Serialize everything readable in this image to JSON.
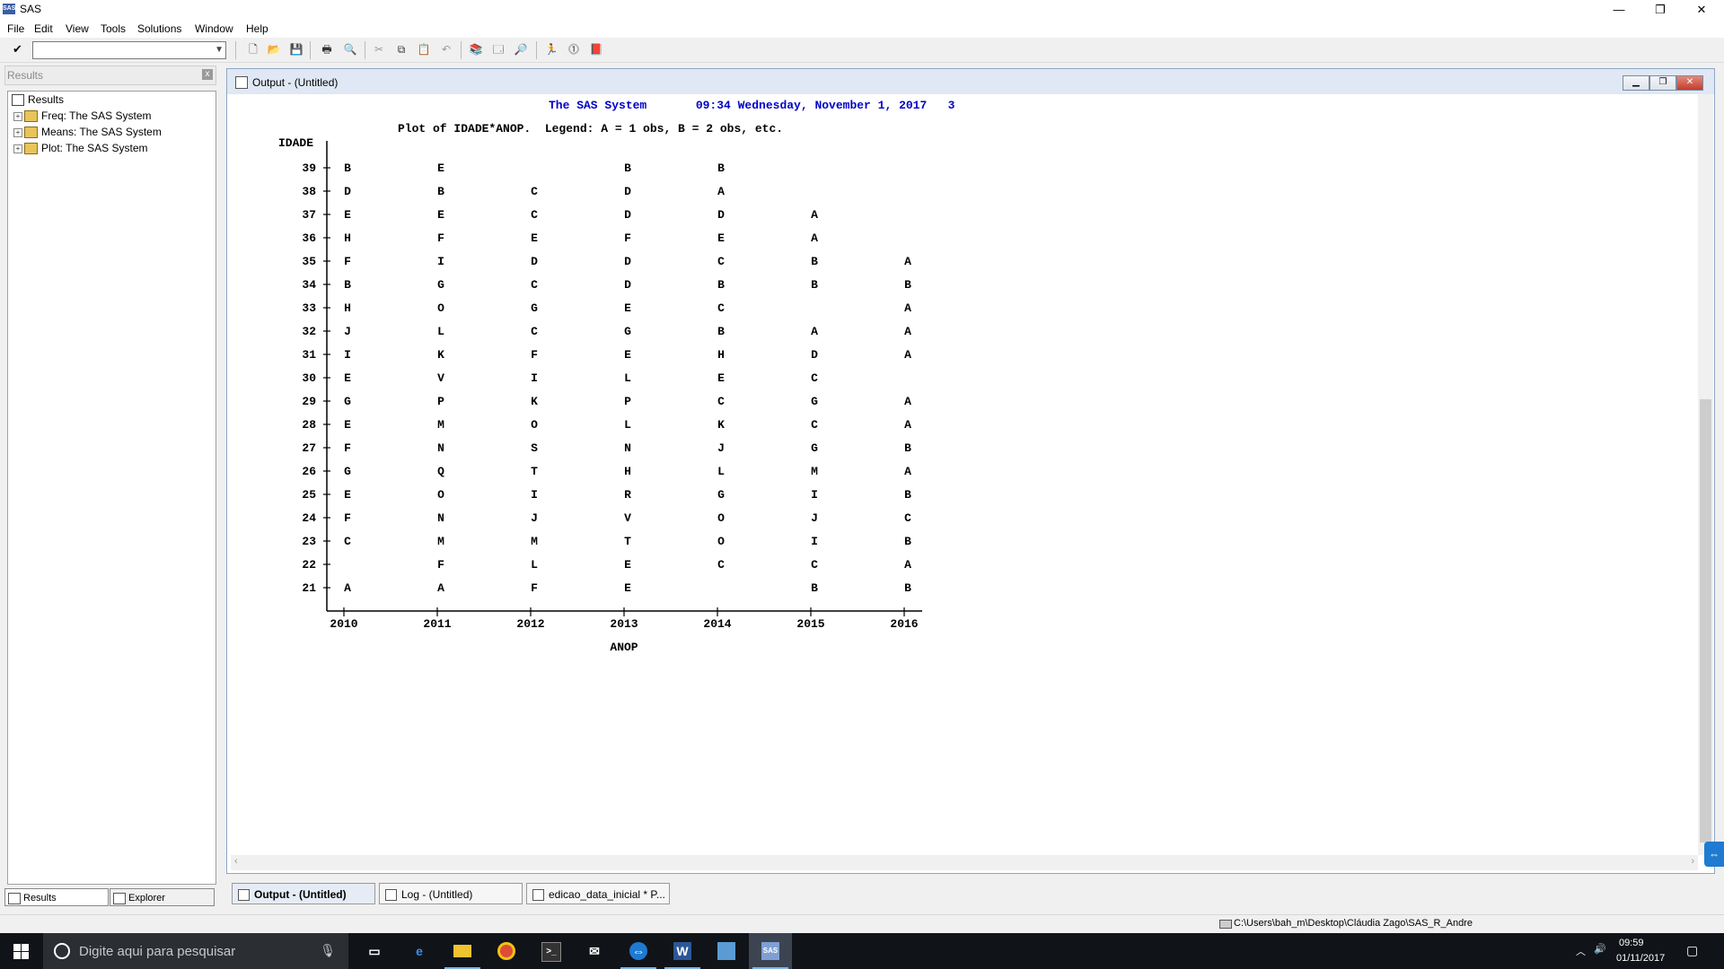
{
  "window": {
    "title": "SAS",
    "min": "—",
    "max": "❐",
    "close": "✕"
  },
  "menu": [
    "File",
    "Edit",
    "View",
    "Tools",
    "Solutions",
    "Window",
    "Help"
  ],
  "toolbar": {
    "command_value": "",
    "icons": [
      "new-icon",
      "open-icon",
      "save-icon",
      "print-icon",
      "print-preview-icon",
      "cut-icon",
      "copy-icon",
      "paste-icon",
      "undo-icon",
      "libraries-icon",
      "explorer-icon",
      "find-icon",
      "submit-icon",
      "break-icon",
      "help-icon"
    ]
  },
  "results_pane": {
    "title": "Results",
    "root": "Results",
    "items": [
      "Freq:  The SAS System",
      "Means:  The SAS System",
      "Plot:  The SAS System"
    ],
    "tabs": [
      "Results",
      "Explorer"
    ]
  },
  "output_window": {
    "title": "Output - (Untitled)",
    "header_line": "The SAS System       09:34 Wednesday, November 1, 2017   3",
    "plot_title": "Plot of IDADE*ANOP.  Legend: A = 1 obs, B = 2 obs, etc.",
    "ylabel": "IDADE",
    "xlabel": "ANOP"
  },
  "chart_data": {
    "type": "scatter",
    "title": "Plot of IDADE*ANOP.  Legend: A = 1 obs, B = 2 obs, etc.",
    "xlabel": "ANOP",
    "ylabel": "IDADE",
    "x": [
      2010,
      2011,
      2012,
      2013,
      2014,
      2015,
      2016
    ],
    "y_ticks": [
      39,
      38,
      37,
      36,
      35,
      34,
      33,
      32,
      31,
      30,
      29,
      28,
      27,
      26,
      25,
      24,
      23,
      22,
      21
    ],
    "grid": false,
    "rows": [
      {
        "y": 39,
        "marks": [
          "B",
          "E",
          "",
          "B",
          "B",
          "",
          ""
        ]
      },
      {
        "y": 38,
        "marks": [
          "D",
          "B",
          "C",
          "D",
          "A",
          "",
          ""
        ]
      },
      {
        "y": 37,
        "marks": [
          "E",
          "E",
          "C",
          "D",
          "D",
          "A",
          ""
        ]
      },
      {
        "y": 36,
        "marks": [
          "H",
          "F",
          "E",
          "F",
          "E",
          "A",
          ""
        ]
      },
      {
        "y": 35,
        "marks": [
          "F",
          "I",
          "D",
          "D",
          "C",
          "B",
          "A"
        ]
      },
      {
        "y": 34,
        "marks": [
          "B",
          "G",
          "C",
          "D",
          "B",
          "B",
          "B"
        ]
      },
      {
        "y": 33,
        "marks": [
          "H",
          "O",
          "G",
          "E",
          "C",
          "",
          "A"
        ]
      },
      {
        "y": 32,
        "marks": [
          "J",
          "L",
          "C",
          "G",
          "B",
          "A",
          "A"
        ]
      },
      {
        "y": 31,
        "marks": [
          "I",
          "K",
          "F",
          "E",
          "H",
          "D",
          "A"
        ]
      },
      {
        "y": 30,
        "marks": [
          "E",
          "V",
          "I",
          "L",
          "E",
          "C",
          ""
        ]
      },
      {
        "y": 29,
        "marks": [
          "G",
          "P",
          "K",
          "P",
          "C",
          "G",
          "A"
        ]
      },
      {
        "y": 28,
        "marks": [
          "E",
          "M",
          "O",
          "L",
          "K",
          "C",
          "A"
        ]
      },
      {
        "y": 27,
        "marks": [
          "F",
          "N",
          "S",
          "N",
          "J",
          "G",
          "B"
        ]
      },
      {
        "y": 26,
        "marks": [
          "G",
          "Q",
          "T",
          "H",
          "L",
          "M",
          "A"
        ]
      },
      {
        "y": 25,
        "marks": [
          "E",
          "O",
          "I",
          "R",
          "G",
          "I",
          "B"
        ]
      },
      {
        "y": 24,
        "marks": [
          "F",
          "N",
          "J",
          "V",
          "O",
          "J",
          "C"
        ]
      },
      {
        "y": 23,
        "marks": [
          "C",
          "M",
          "M",
          "T",
          "O",
          "I",
          "B"
        ]
      },
      {
        "y": 22,
        "marks": [
          "",
          "F",
          "L",
          "E",
          "C",
          "C",
          "A"
        ]
      },
      {
        "y": 21,
        "marks": [
          "A",
          "A",
          "F",
          "E",
          "",
          "B",
          "B"
        ]
      }
    ]
  },
  "window_tabs": [
    "Output - (Untitled)",
    "Log - (Untitled)",
    "edicao_data_inicial *   P..."
  ],
  "status": {
    "path": "C:\\Users\\bah_m\\Desktop\\Cláudia Zago\\SAS_R_Andre"
  },
  "taskbar": {
    "search_placeholder": "Digite aqui para pesquisar",
    "time": "09:59",
    "date": "01/11/2017"
  }
}
